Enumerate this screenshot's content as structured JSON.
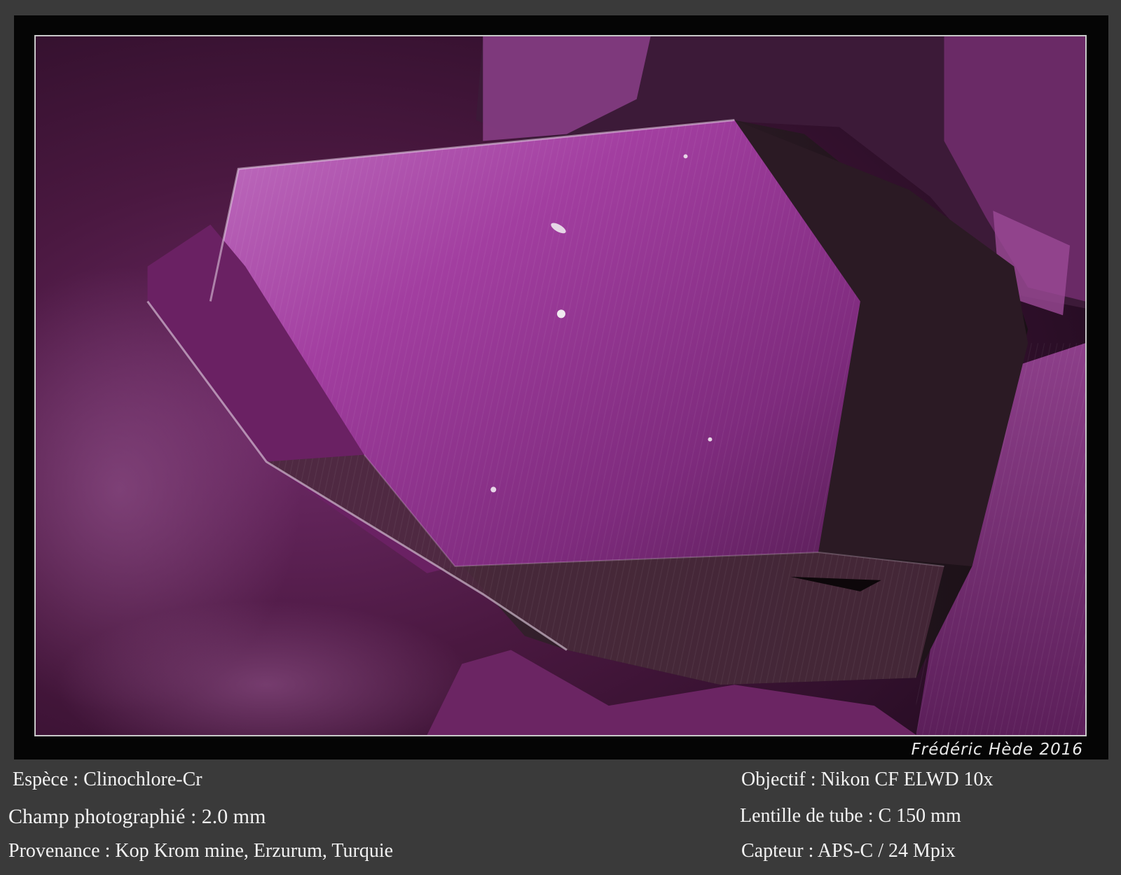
{
  "photo": {
    "subject": "Clinochlore-Cr crystal",
    "palette": {
      "background": "#4a1840",
      "crystal_highlight": "#b44db0",
      "crystal_mid": "#8a2f87",
      "crystal_dark": "#2b1a24",
      "edge": "#e6d4e6"
    }
  },
  "signature": "Frédéric Hède 2016",
  "captions": {
    "species": "Espèce : Clinochlore-Cr",
    "field": "Champ photographié : 2.0 mm",
    "origin": "Provenance : Kop Krom mine,  Erzurum, Turquie",
    "objective": "Objectif : Nikon CF ELWD 10x",
    "tube_lens": "Lentille de tube : C 150 mm",
    "sensor": "Capteur : APS-C / 24 Mpix"
  }
}
